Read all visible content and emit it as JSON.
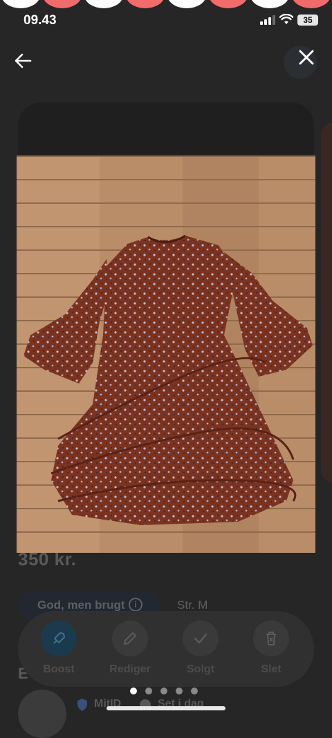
{
  "status_bar": {
    "time": "09.43",
    "battery": "35"
  },
  "listing": {
    "price": "350 kr.",
    "condition": "God, men brugt",
    "size": "Str. M",
    "section_letter": "E",
    "seller_badge": "MitID",
    "seller_seen": "Set i dag"
  },
  "actions": [
    {
      "label": "Boost",
      "icon": "rocket-icon"
    },
    {
      "label": "Rediger",
      "icon": "pencil-icon"
    },
    {
      "label": "Solgt",
      "icon": "check-icon"
    },
    {
      "label": "Slet",
      "icon": "trash-icon"
    }
  ],
  "lightbox": {
    "image_count": 5,
    "active_index": 0
  },
  "colors": {
    "notif_white": "#ffffff",
    "notif_red": "#f26b6b",
    "dress": "#7b3322",
    "floor": "#b88c66"
  }
}
